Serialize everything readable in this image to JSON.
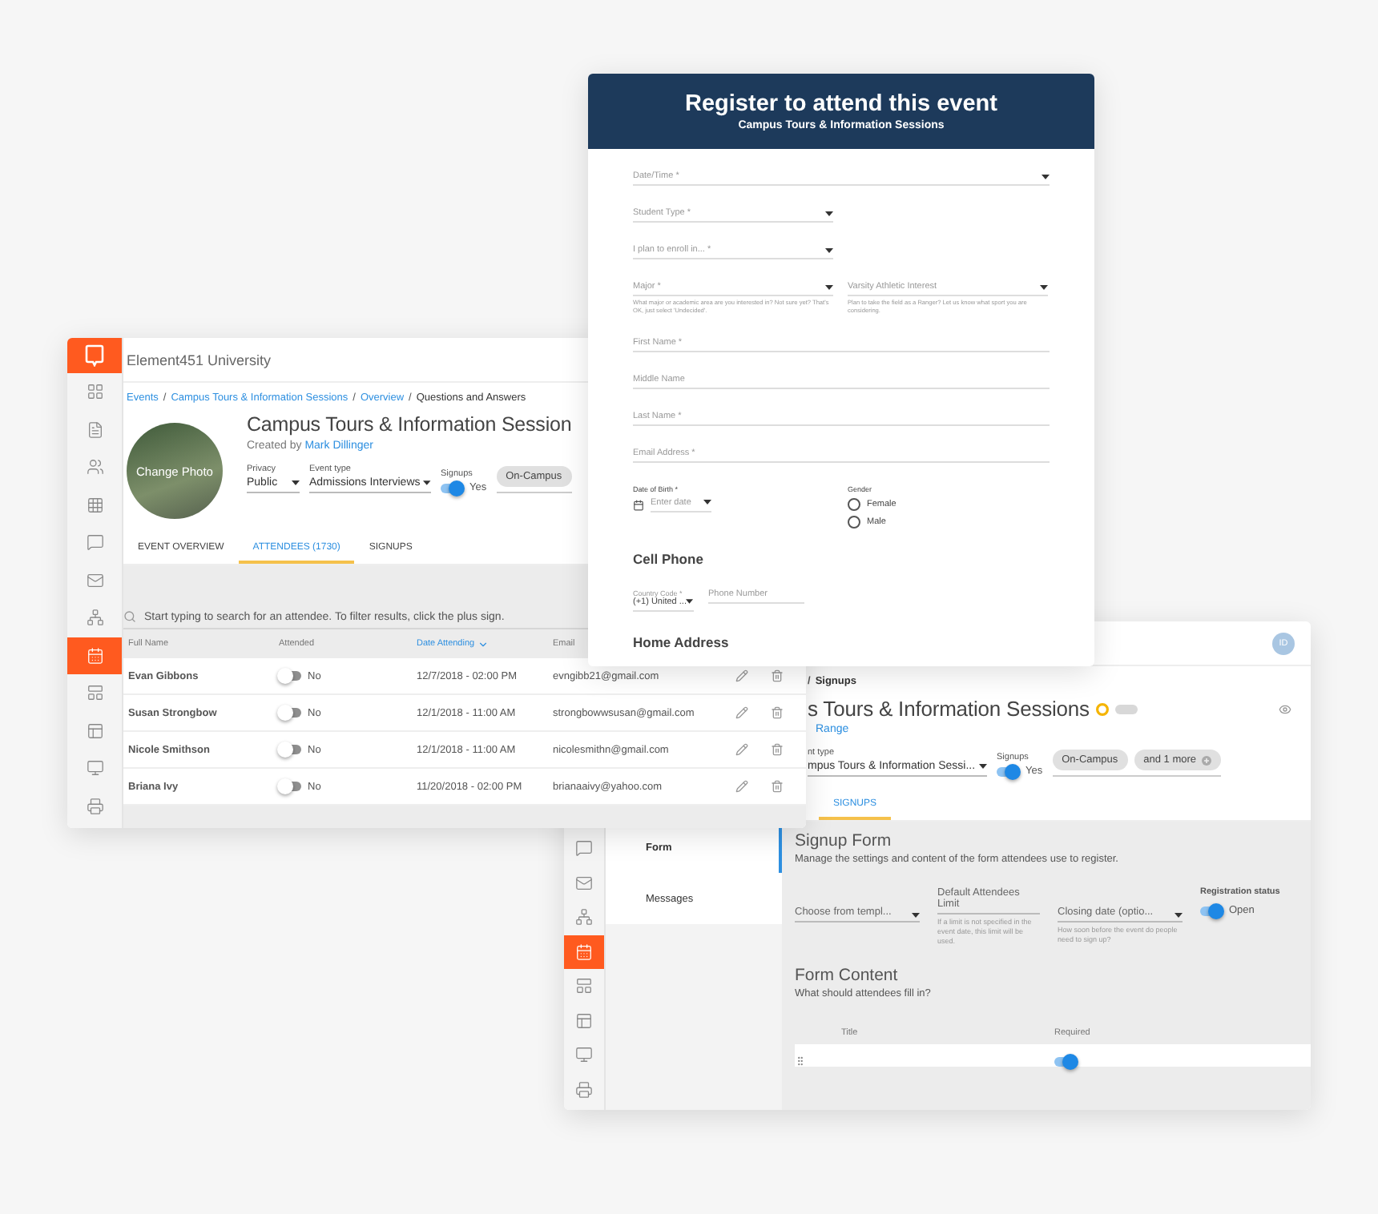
{
  "attendees_window": {
    "app_name": "Element451 University",
    "nav": [
      {
        "selected": false
      },
      {
        "selected": false
      },
      {
        "selected": false
      },
      {
        "selected": false
      },
      {
        "selected": false
      },
      {
        "selected": false
      },
      {
        "selected": false
      },
      {
        "selected": true
      },
      {
        "selected": false
      },
      {
        "selected": false
      },
      {
        "selected": false
      },
      {
        "selected": false
      }
    ],
    "breadcrumb_separator": "/",
    "breadcrumb": [
      {
        "label": "Events",
        "link": true
      },
      {
        "label": "Campus Tours & Information Sessions",
        "link": true
      },
      {
        "label": "Overview",
        "link": true
      },
      {
        "label": "Questions and Answers",
        "link": false
      }
    ],
    "photo_label": "Change Photo",
    "title": "Campus Tours & Information Session",
    "created_by": "Created by",
    "creator": "Mark Dillinger",
    "privacy": {
      "label": "Privacy",
      "value": "Public"
    },
    "event_type": {
      "label": "Event type",
      "value": "Admissions Interviews"
    },
    "signups": {
      "label": "Signups",
      "on": true,
      "value": "Yes"
    },
    "tags": [
      "On-Campus"
    ],
    "tabs": [
      {
        "label": "EVENT OVERVIEW",
        "selected": false
      },
      {
        "label": "ATTENDEES (1730)",
        "selected": true
      },
      {
        "label": "SIGNUPS",
        "selected": false
      }
    ],
    "search": {
      "placeholder": "Start typing to search for an attendee. To filter results, click the plus sign."
    },
    "columns": [
      {
        "label": "Full Name",
        "sorted": false
      },
      {
        "label": "Attended",
        "sorted": false
      },
      {
        "label": "Date Attending",
        "sorted": true
      },
      {
        "label": "Email",
        "sorted": false
      }
    ],
    "rows": [
      {
        "name": "Evan Gibbons",
        "attended": false,
        "attended_label": "No",
        "date": "12/7/2018 - 02:00 PM",
        "email": "evngibb21@gmail.com"
      },
      {
        "name": "Susan Strongbow",
        "attended": false,
        "attended_label": "No",
        "date": "12/1/2018 - 11:00 AM",
        "email": "strongbowwsusan@gmail.com"
      },
      {
        "name": "Nicole Smithson",
        "attended": false,
        "attended_label": "No",
        "date": "12/1/2018 - 11:00 AM",
        "email": "nicolesmithn@gmail.com"
      },
      {
        "name": "Briana Ivy",
        "attended": false,
        "attended_label": "No",
        "date": "11/20/2018 - 02:00 PM",
        "email": "brianaaivy@yahoo.com"
      }
    ]
  },
  "register_form": {
    "title": "Register to attend this event",
    "subtitle": "Campus Tours & Information Sessions",
    "rows": [
      [
        {
          "kind": "wideselect",
          "label": "Date/Time *"
        }
      ],
      [
        {
          "kind": "select",
          "label": "Student Type *"
        }
      ],
      [
        {
          "kind": "select",
          "label": "I plan to enroll in... *"
        }
      ],
      [
        {
          "kind": "select",
          "label": "Major *",
          "hint": "What major or academic area are you interested in? Not sure yet? That's OK, just select 'Undecided'."
        },
        {
          "kind": "select",
          "label": "Varsity Athletic Interest",
          "hint": "Plan to take the field as a Ranger? Let us know what sport you are considering."
        }
      ],
      [
        {
          "kind": "text",
          "label": "First Name *"
        }
      ],
      [
        {
          "kind": "text",
          "label": "Middle Name"
        }
      ],
      [
        {
          "kind": "text",
          "label": "Last Name *"
        }
      ],
      [
        {
          "kind": "text",
          "label": "Email Address *"
        }
      ],
      [
        {
          "kind": "date",
          "label": "Date of Birth *",
          "placeholder": "Enter date"
        },
        {
          "kind": "radio",
          "label": "Gender",
          "options": [
            {
              "label": "Female",
              "selected": false
            },
            {
              "label": "Male",
              "selected": false
            }
          ]
        }
      ],
      [
        {
          "kind": "heading",
          "label": "Cell Phone"
        }
      ],
      [
        {
          "kind": "codeselect",
          "label": "Country Code *",
          "value": "(+1) United ..."
        },
        {
          "kind": "phone",
          "placeholder": "Phone Number"
        }
      ],
      [
        {
          "kind": "heading",
          "label": "Home Address"
        }
      ]
    ]
  },
  "signups_window": {
    "avatar": "ID",
    "nav": [
      {
        "selected": false
      },
      {
        "selected": false
      },
      {
        "selected": false
      },
      {
        "selected": true
      },
      {
        "selected": false
      },
      {
        "selected": false
      },
      {
        "selected": false
      },
      {
        "selected": false
      }
    ],
    "breadcrumb_separator": "/",
    "breadcrumb_current": "Signups",
    "title": "s Tours & Information Sessions",
    "date_link": "Range",
    "event_type": {
      "label": "nt type",
      "value": "mpus Tours & Information Sessi..."
    },
    "signups": {
      "label": "Signups",
      "on": true,
      "value": "Yes"
    },
    "tags": [
      {
        "label": "On-Campus",
        "kind": "plain"
      },
      {
        "label": "and 1 more",
        "kind": "more"
      }
    ],
    "tabs": [
      {
        "label": "SIGNUPS",
        "selected": true
      }
    ],
    "sections": [
      {
        "label": "Form",
        "selected": true
      },
      {
        "label": "Messages",
        "selected": false
      }
    ],
    "form_title": "Signup Form",
    "form_description": "Manage the settings and content of the form attendees use to register.",
    "template": {
      "placeholder": "Choose from templ..."
    },
    "limit": {
      "label": "Default Attendees Limit",
      "hint": "If a limit is not specified in the event date, this limit will be used."
    },
    "closing": {
      "placeholder": "Closing date (optio...",
      "hint": "How soon before the event do people need to sign up?"
    },
    "registration": {
      "label": "Registration status",
      "on": true,
      "value": "Open"
    },
    "content_title": "Form Content",
    "content_subtitle": "What should attendees fill in?",
    "columns": [
      "Title",
      "Required"
    ],
    "rows": [
      {
        "required": true
      }
    ]
  }
}
